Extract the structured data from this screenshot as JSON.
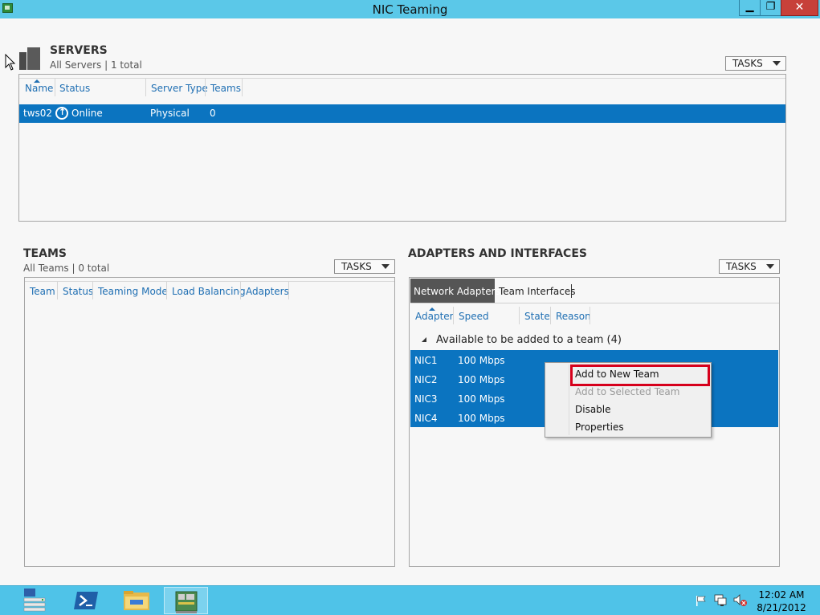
{
  "window": {
    "title": "NIC Teaming",
    "minimize_glyph": "▁",
    "maximize_glyph": "❐",
    "close_glyph": "✕"
  },
  "servers": {
    "title": "SERVERS",
    "subtitle": "All Servers | 1 total",
    "tasks_label": "TASKS",
    "columns": [
      "Name",
      "Status",
      "Server Type",
      "Teams"
    ],
    "rows": [
      {
        "name": "tws02",
        "status": "Online",
        "server_type": "Physical",
        "teams": "0"
      }
    ]
  },
  "teams": {
    "title": "TEAMS",
    "subtitle": "All Teams | 0 total",
    "tasks_label": "TASKS",
    "columns": [
      "Team",
      "Status",
      "Teaming Mode",
      "Load Balancing",
      "Adapters"
    ]
  },
  "adapters": {
    "title": "ADAPTERS AND INTERFACES",
    "tasks_label": "TASKS",
    "tabs": [
      "Network Adapters",
      "Team Interfaces"
    ],
    "active_tab": "Network Adapters",
    "columns": [
      "Adapter",
      "Speed",
      "State",
      "Reason"
    ],
    "group_label": "Available to be added to a team (4)",
    "rows": [
      {
        "adapter": "NIC1",
        "speed": "100 Mbps"
      },
      {
        "adapter": "NIC2",
        "speed": "100 Mbps"
      },
      {
        "adapter": "NIC3",
        "speed": "100 Mbps"
      },
      {
        "adapter": "NIC4",
        "speed": "100 Mbps"
      }
    ]
  },
  "context_menu": {
    "items": [
      {
        "label": "Add to New Team",
        "enabled": true,
        "highlighted": true
      },
      {
        "label": "Add to Selected Team",
        "enabled": false
      },
      {
        "label": "Disable",
        "enabled": true
      },
      {
        "label": "Properties",
        "enabled": true
      }
    ],
    "highlight_color": "#d6001c"
  },
  "taskbar": {
    "apps": [
      "server-manager-icon",
      "powershell-icon",
      "file-explorer-icon",
      "nic-teaming-icon"
    ],
    "time": "12:02 AM",
    "date": "8/21/2012"
  },
  "colors": {
    "title_bar": "#5bc8e8",
    "selection": "#0b74c0",
    "column_header": "#1f6fb3",
    "close_button": "#c7413a",
    "taskbar": "#4fc3e8"
  }
}
